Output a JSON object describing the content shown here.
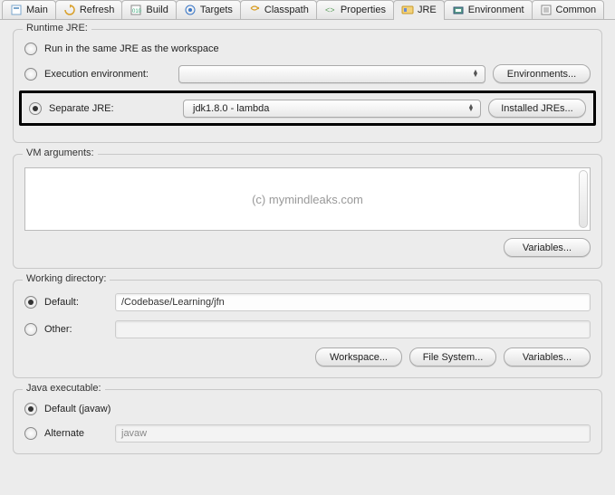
{
  "tabs": {
    "main": "Main",
    "refresh": "Refresh",
    "build": "Build",
    "targets": "Targets",
    "classpath": "Classpath",
    "properties": "Properties",
    "jre": "JRE",
    "environment": "Environment",
    "common": "Common"
  },
  "runtime": {
    "title": "Runtime JRE:",
    "option_same": "Run in the same JRE as the workspace",
    "option_env": "Execution environment:",
    "option_sep": "Separate JRE:",
    "env_select": "",
    "sep_select": "jdk1.8.0 - lambda",
    "btn_env": "Environments...",
    "btn_installed": "Installed JREs..."
  },
  "vmargs": {
    "title": "VM arguments:",
    "watermark": "(c) mymindleaks.com",
    "btn_vars": "Variables..."
  },
  "workdir": {
    "title": "Working directory:",
    "default_label": "Default:",
    "default_value": "/Codebase/Learning/jfn",
    "other_label": "Other:",
    "other_value": "",
    "btn_workspace": "Workspace...",
    "btn_filesystem": "File System...",
    "btn_vars": "Variables..."
  },
  "javaexec": {
    "title": "Java executable:",
    "default_label": "Default (javaw)",
    "alt_label": "Alternate",
    "alt_value": "javaw"
  }
}
